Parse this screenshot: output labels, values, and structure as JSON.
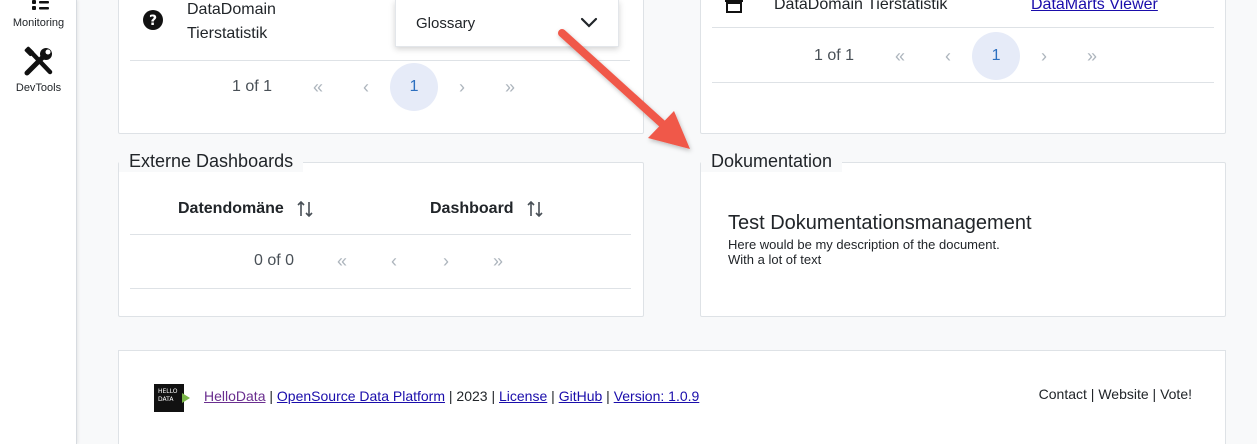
{
  "sidebar": {
    "items": [
      {
        "label": "Monitoring",
        "icon": "monitoring-icon"
      },
      {
        "label": "DevTools",
        "icon": "tools-icon"
      }
    ]
  },
  "datadomain_panel": {
    "row_label_line1": "DataDomain",
    "row_label_line2": "Tierstatistik",
    "dropdown_label": "Glossary",
    "pager": {
      "count": "1 of 1",
      "page": "1"
    }
  },
  "datamarts_panel": {
    "row_label": "DataDomain Tierstatistik",
    "row_link": "DataMarts Viewer",
    "pager": {
      "count": "1 of 1",
      "page": "1"
    }
  },
  "external_dashboards": {
    "title": "Externe Dashboards",
    "columns": [
      "Datendomäne",
      "Dashboard"
    ],
    "pager": {
      "count": "0 of 0"
    }
  },
  "documentation": {
    "title": "Dokumentation",
    "doc_title": "Test Dokumentationsmanagement",
    "doc_line1": "Here would be my description of the document.",
    "doc_line2": "With a lot of text"
  },
  "footer": {
    "logo_text_top": "HELLO",
    "logo_text_bottom": "DATA",
    "brand": "HelloData",
    "platform": "OpenSource Data Platform",
    "year": "2023",
    "license": "License",
    "github": "GitHub",
    "version": "Version: 1.0.9",
    "sep": "|",
    "right_contact": "Contact",
    "right_website": "Website",
    "right_vote": "Vote!"
  },
  "colors": {
    "accent_arrow": "#f0584a",
    "page_active_bg": "#e6ebf8",
    "page_active_fg": "#2c6fbf",
    "link": "#1a0dab",
    "logo_green": "#7ab648"
  }
}
